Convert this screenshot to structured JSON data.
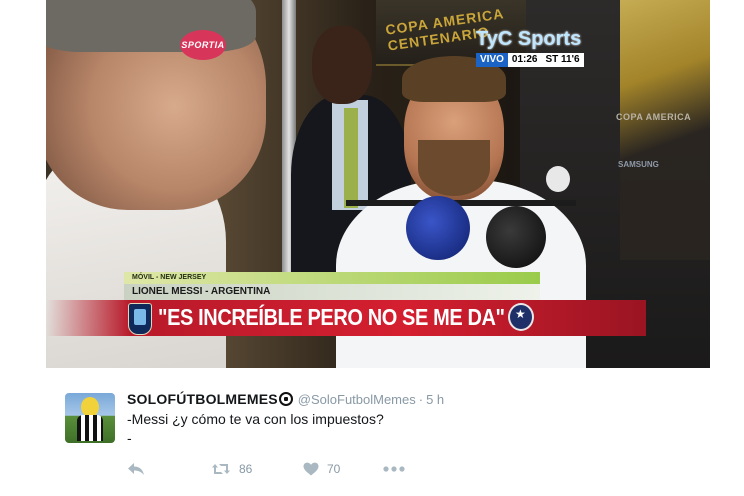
{
  "video": {
    "channel_logo": "SPORTIA",
    "venue_banner": "COPA AMERICA CENTENARIO",
    "broadcaster": "TyC Sports",
    "live_label": "VIVO",
    "clock_time": "01:26",
    "clock_period": "ST 11'6",
    "copa_sign": "COPA AMERICA",
    "sponsor_sign": "SAMSUNG",
    "location_strip": "MÓVIL - NEW JERSEY",
    "player_caption": "LIONEL MESSI - ARGENTINA",
    "quote": "\"ES INCREÍBLE PERO NO SE ME DA\""
  },
  "tweet": {
    "display_name": "SOLOFÚTBOLMEMES",
    "name_emoji": "soccer-ball-icon",
    "handle": "@SoloFutbolMemes",
    "separator": "·",
    "time": "5 h",
    "body": "-Messi ¿y cómo te va con los impuestos?\n-",
    "retweets": "86",
    "likes": "70"
  },
  "colors": {
    "quote_red": "#d41f30",
    "retweet_green_grey": "#aab8c2",
    "handle_grey": "#8899a6",
    "name_text": "#14171a"
  }
}
